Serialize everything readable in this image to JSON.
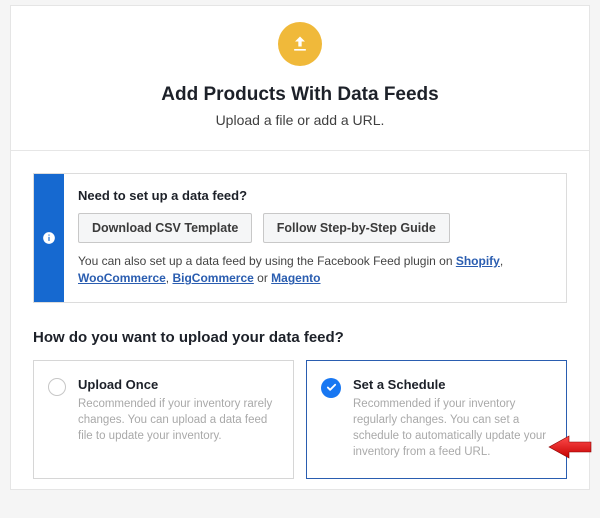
{
  "header": {
    "title": "Add Products With Data Feeds",
    "subtitle": "Upload a file or add a URL."
  },
  "info": {
    "title": "Need to set up a data feed?",
    "download_label": "Download CSV Template",
    "guide_label": "Follow Step-by-Step Guide",
    "desc_prefix": "You can also set up a data feed by using the Facebook Feed plugin on ",
    "brand_shopify": "Shopify",
    "sep1": ", ",
    "brand_woo": "WooCommerce",
    "sep2": ", ",
    "brand_big": "BigCommerce",
    "sep3": " or ",
    "brand_magento": "Magento"
  },
  "question": "How do you want to upload your data feed?",
  "options": {
    "once": {
      "title": "Upload Once",
      "desc": "Recommended if your inventory rarely changes. You can upload a data feed file to update your inventory."
    },
    "schedule": {
      "title": "Set a Schedule",
      "desc": "Recommended if your inventory regularly changes. You can set a schedule to automatically update your inventory from a feed URL."
    }
  }
}
